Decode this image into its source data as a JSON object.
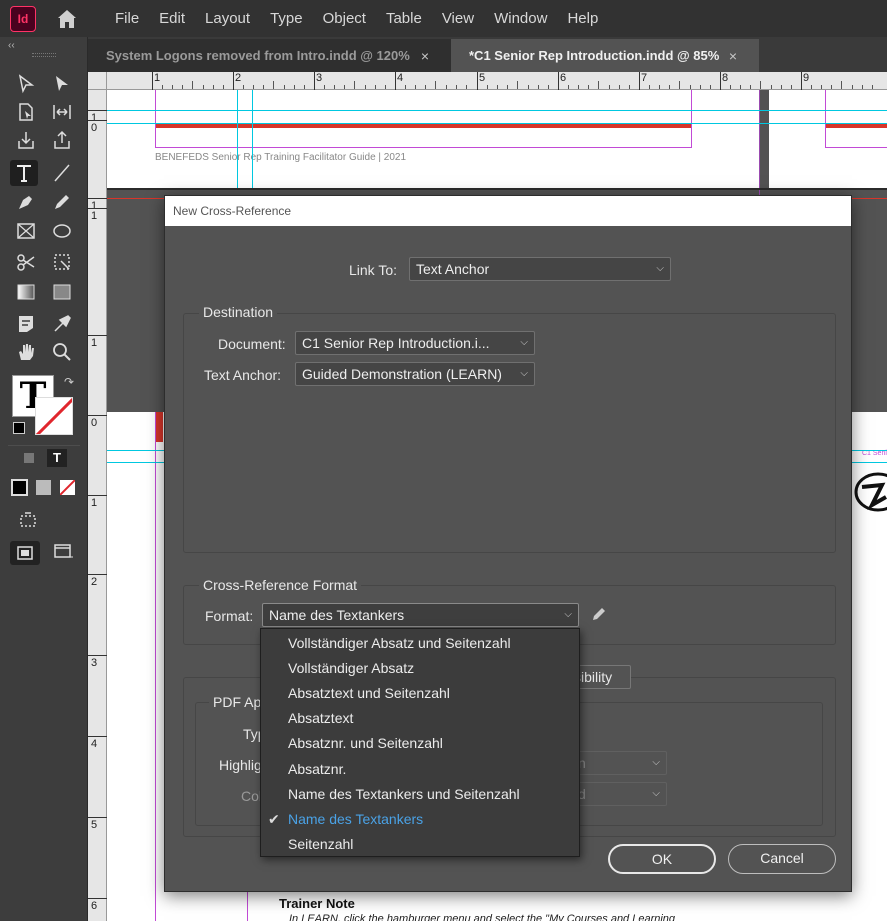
{
  "app": {
    "logo": "Id"
  },
  "menu": [
    "File",
    "Edit",
    "Layout",
    "Type",
    "Object",
    "Table",
    "View",
    "Window",
    "Help"
  ],
  "tabs": [
    {
      "title": "System Logons removed from Intro.indd @ 120%",
      "active": false
    },
    {
      "title": "*C1 Senior Rep Introduction.indd @ 85%",
      "active": true
    }
  ],
  "tab_close_glyph": "×",
  "toolbar": {
    "collapse_glyph": "‹‹"
  },
  "ruler": {
    "h_labels": [
      "1",
      "2",
      "3",
      "4",
      "5",
      "6",
      "7",
      "8",
      "9"
    ],
    "v_labels": [
      "1",
      "0",
      "1",
      "1",
      "1",
      "0",
      "1",
      "2",
      "3",
      "4",
      "5",
      "6"
    ]
  },
  "document": {
    "footer_brand": "BENEFEDS",
    "footer_text": " Senior Rep Training Facilitator Guide  | 2021",
    "trainer_note": "Trainer Note",
    "trainer_line": "In LEARN, click the hamburger menu and select the \"My Courses and Learning",
    "side_text": "C1 Seni"
  },
  "dialog": {
    "title": "New Cross-Reference",
    "link_to_label": "Link To:",
    "link_to_value": "Text Anchor",
    "destination_title": "Destination",
    "document_label": "Document:",
    "document_value": "C1 Senior Rep Introduction.i...",
    "text_anchor_label": "Text Anchor:",
    "text_anchor_value": "Guided Demonstration (LEARN)",
    "format_title": "Cross-Reference Format",
    "format_label": "Format:",
    "format_value": "Name des Textankers",
    "pdf_title": "PDF App",
    "type_label": "Typ",
    "highlight_label": "Highlig",
    "color_label": "Col",
    "visibility_button": "sibility",
    "highlight_value": "n",
    "color_value": "d",
    "ok": "OK",
    "cancel": "Cancel"
  },
  "format_options": [
    {
      "label": "Vollständiger Absatz und Seitenzahl",
      "checked": false
    },
    {
      "label": "Vollständiger Absatz",
      "checked": false
    },
    {
      "label": "Absatztext und Seitenzahl",
      "checked": false
    },
    {
      "label": "Absatztext",
      "checked": false
    },
    {
      "label": "Absatznr. und Seitenzahl",
      "checked": false
    },
    {
      "label": "Absatznr.",
      "checked": false
    },
    {
      "label": "Name des Textankers und Seitenzahl",
      "checked": false
    },
    {
      "label": "Name des Textankers",
      "checked": true
    },
    {
      "label": "Seitenzahl",
      "checked": false
    }
  ],
  "check_glyph": "✔",
  "chevron_glyph": "⌵",
  "colors": {
    "accent_blue": "#4aa2e6",
    "guide_cyan": "#00e5ff",
    "margin_magenta": "#c24ad6",
    "red_bar": "#d8352a"
  }
}
